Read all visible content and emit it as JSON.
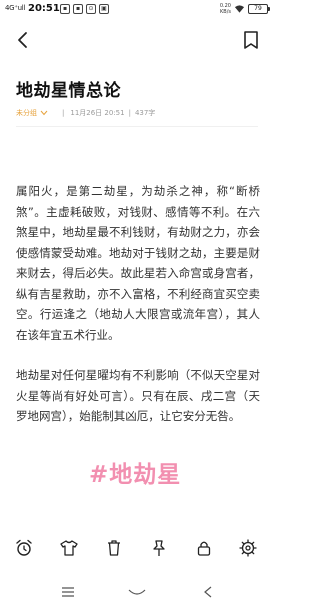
{
  "status_bar": {
    "signal": "4G⁺ull",
    "time": "20:51",
    "speed_value": "0.20",
    "speed_unit": "KB/s",
    "battery": "79"
  },
  "header": {
    "back_icon": "chevron-left-icon",
    "bookmark_icon": "bookmark-icon"
  },
  "article": {
    "title": "地劫星情总论",
    "category": "未分组",
    "date": "11月26日 20:51",
    "separator": "|",
    "word_count": "437字",
    "paragraphs": [
      "属阳火，是第二劫星，为劫杀之神，称“断桥煞”。主虚耗破败，对钱财、感情等不利。在六煞星中，地劫星最不利钱财，有劫财之力，亦会使感情蒙受劫难。地劫对于钱财之劫，主要是财来财去，得后必失。故此星若入命宫或身宫者，纵有吉星救助，亦不入富格，不利经商宜买空卖空。行运逢之（地劫人大限宫或流年宫），其人在该年宜五术行业。",
      "地劫星对任何星曜均有不利影响（不似天空星对火星等尚有好处可言）。只有在辰、戌二宫（天罗地网宫），始能制其凶厄，让它安分无咎。"
    ],
    "hashtag": "#地劫星"
  },
  "toolbar": {
    "items": [
      "alarm-clock-icon",
      "tshirt-icon",
      "trash-icon",
      "pin-icon",
      "lock-icon",
      "settings-icon"
    ]
  },
  "navbar": {
    "items": [
      "menu-icon",
      "home-icon",
      "back-icon"
    ]
  },
  "colors": {
    "accent": "#e6a23c",
    "hashtag": "#f28fb0",
    "text": "#333333"
  }
}
